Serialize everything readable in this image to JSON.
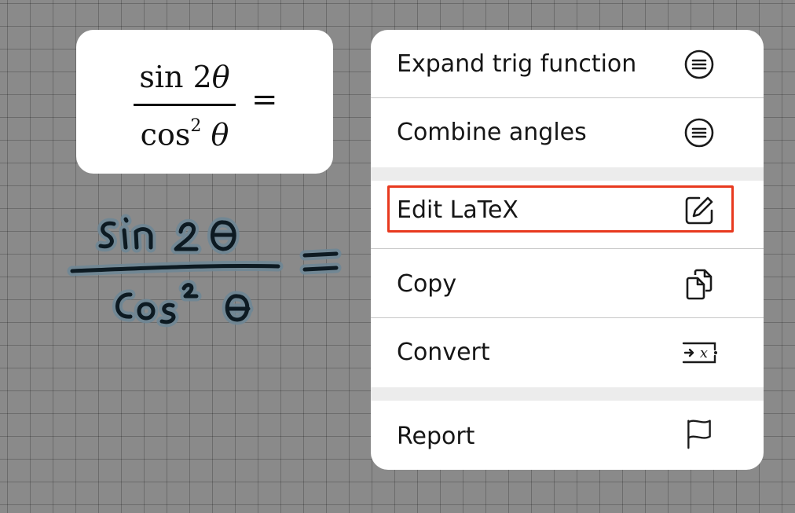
{
  "preview": {
    "numerator_fn": "sin 2",
    "numerator_var": "θ",
    "denominator_fn": "cos",
    "denominator_exp": "2",
    "denominator_var": "θ",
    "equals": "="
  },
  "menu": {
    "items": [
      {
        "label": "Expand trig function",
        "icon": "equivalent-icon"
      },
      {
        "label": "Combine angles",
        "icon": "equivalent-icon"
      },
      {
        "label": "Edit LaTeX",
        "icon": "edit-icon",
        "highlighted": true
      },
      {
        "label": "Copy",
        "icon": "copy-icon"
      },
      {
        "label": "Convert",
        "icon": "convert-icon"
      },
      {
        "label": "Report",
        "icon": "flag-icon"
      }
    ]
  },
  "colors": {
    "highlight": "#e8391e",
    "canvas": "#8a8a8a",
    "ink": "#0d1a22",
    "ink_halo": "#6f8796"
  }
}
